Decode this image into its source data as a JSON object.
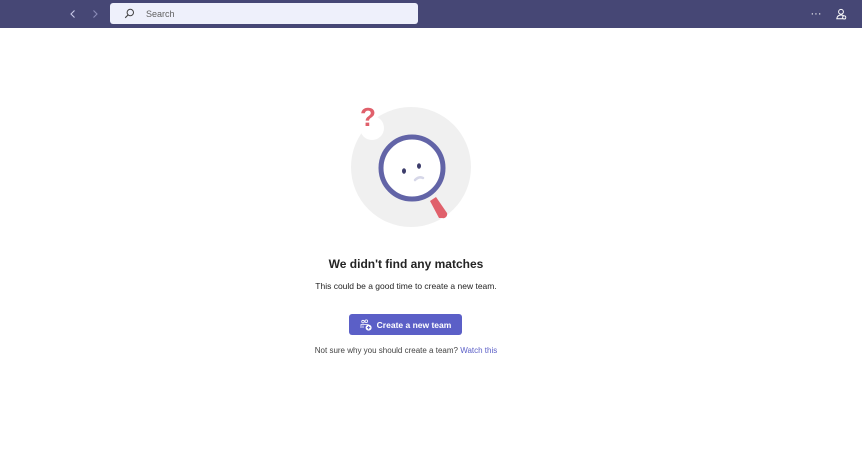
{
  "header": {
    "search": {
      "placeholder": "Search",
      "value": ""
    },
    "more_label": "···"
  },
  "empty_state": {
    "question_mark": "?",
    "title": "We didn't find any matches",
    "subtitle": "This could be a good time to create a new team.",
    "create_button_label": "Create a new team",
    "footnote_text": "Not sure why you should create a team?",
    "footnote_link": "Watch this"
  },
  "colors": {
    "topbar": "#464775",
    "accent": "#5b5fc7",
    "search_bg": "#eef0fb",
    "question_mark": "#e0606b",
    "circle_bg": "#f0f0f0"
  },
  "icons": {
    "back": "chevron-left-icon",
    "forward": "chevron-right-icon",
    "search": "search-icon",
    "more": "more-icon",
    "profile": "person-icon",
    "create_team": "team-add-icon"
  }
}
